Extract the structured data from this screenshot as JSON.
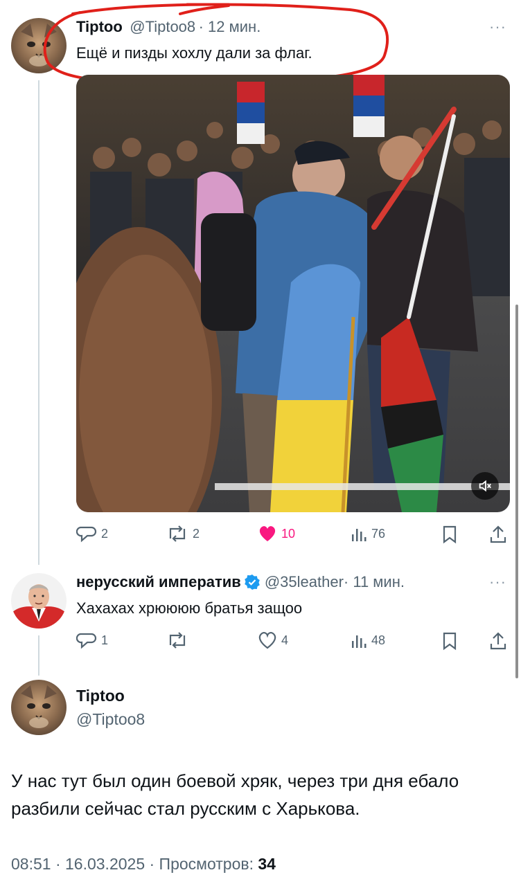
{
  "tweet1": {
    "name": "Tiptoo",
    "handle": "@Tiptoo8",
    "time": "· 12 мин.",
    "text": "Ещё и пизды хохлу дали за флаг.",
    "replies": "2",
    "retweets": "2",
    "likes": "10",
    "views": "76"
  },
  "tweet2": {
    "name": "нерусский императив",
    "handle": "@35leather",
    "time": "· 11 мин.",
    "text": "Хахахах хрюююю братья защоо",
    "replies": "1",
    "likes": "4",
    "views": "48"
  },
  "main_tweet": {
    "name": "Tiptoo",
    "handle": "@Tiptoo8",
    "text": "У нас тут был один боевой хряк, через три дня ебало разбили сейчас стал русским с Харькова.",
    "timestamp": "08:51 · 16.03.2025 · Просмотров: ",
    "views_count": "34"
  },
  "more_glyph": "···",
  "colors": {
    "like_active": "#f91880",
    "annotation_red": "#e0201a",
    "verified_blue": "#1d9bf0",
    "muted_text": "#536471"
  },
  "icons": [
    "reply-icon",
    "retweet-icon",
    "like-icon",
    "views-icon",
    "bookmark-icon",
    "share-icon",
    "mute-icon",
    "verified-icon"
  ]
}
